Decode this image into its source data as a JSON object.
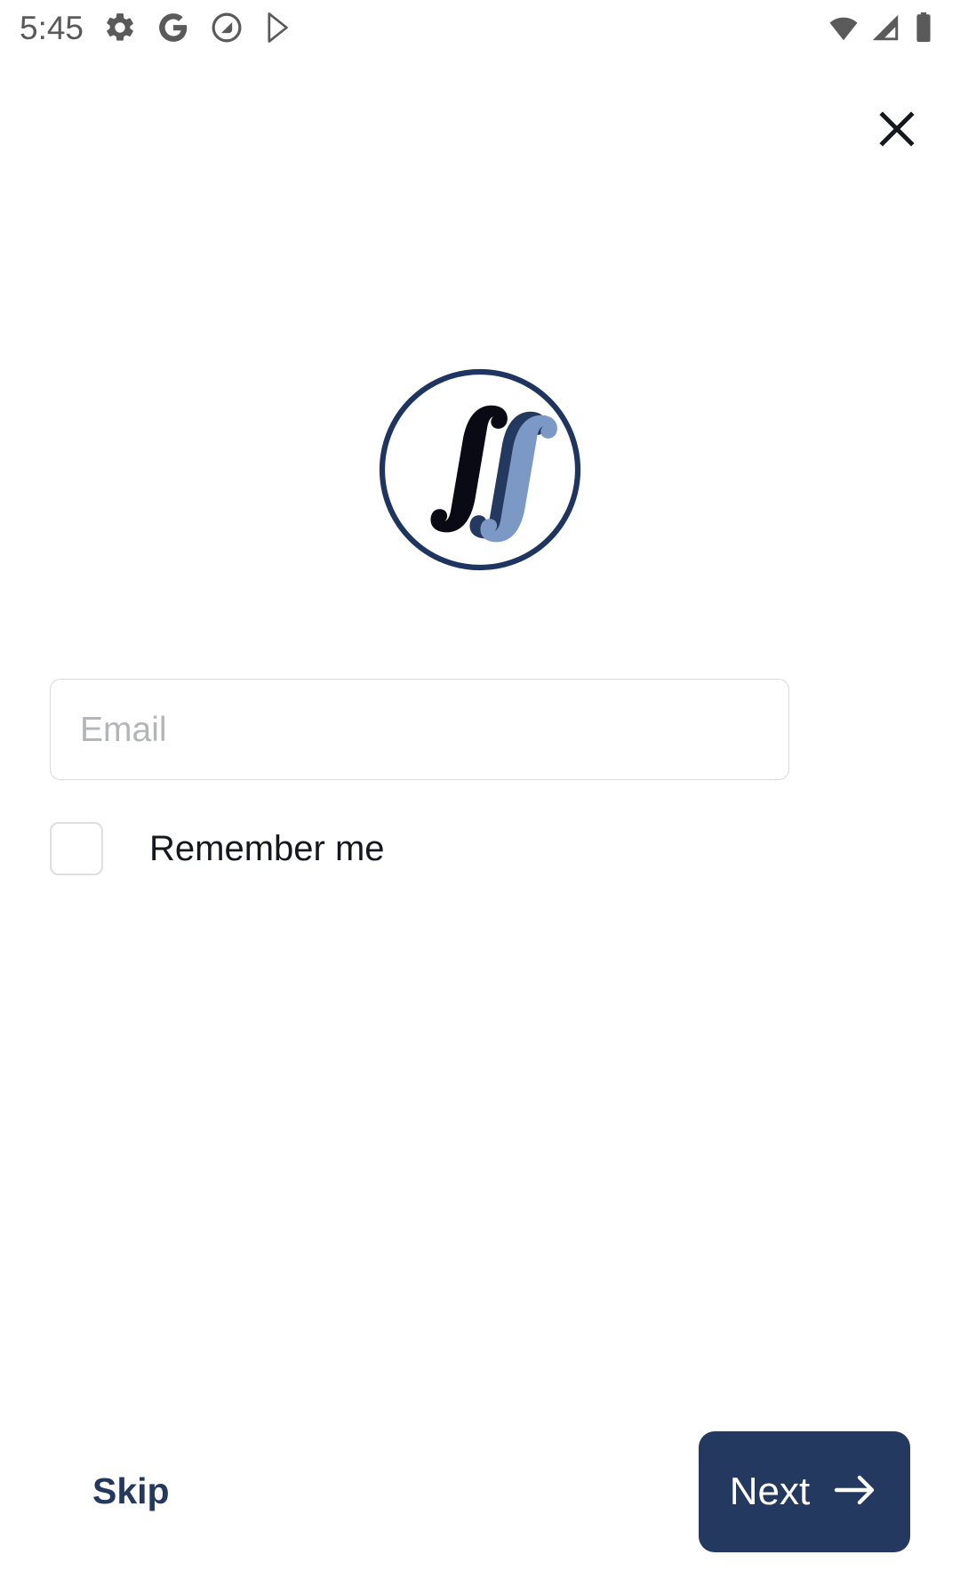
{
  "status_bar": {
    "time": "5:45",
    "left_icons": [
      {
        "name": "settings-gear-icon",
        "label": "Settings"
      },
      {
        "name": "google-g-icon",
        "label": "Google"
      },
      {
        "name": "circle-arrow-icon",
        "label": "Notification"
      },
      {
        "name": "play-store-icon",
        "label": "Play Store"
      }
    ],
    "right_icons": [
      {
        "name": "wifi-icon",
        "label": "Wi-Fi"
      },
      {
        "name": "cellular-signal-icon",
        "label": "Cellular signal"
      },
      {
        "name": "battery-icon",
        "label": "Battery"
      }
    ],
    "text_color": "#5a5a5a"
  },
  "header": {
    "close_label": "Close",
    "close_icon": "close-x-icon"
  },
  "logo": {
    "name": "app-logo",
    "alt": "Triple integral logo",
    "circle_color": "#1e3561",
    "stroke_colors": [
      "#0a0a14",
      "#24395f",
      "#7b99c4"
    ]
  },
  "form": {
    "email": {
      "placeholder": "Email",
      "value": "",
      "placeholder_color": "#b3b5b9",
      "border_color": "#d8dadd"
    },
    "remember_me": {
      "label": "Remember me",
      "checked": false
    }
  },
  "footer": {
    "skip_label": "Skip",
    "next_label": "Next",
    "next_icon": "arrow-right-icon",
    "accent_color": "#24395f"
  }
}
